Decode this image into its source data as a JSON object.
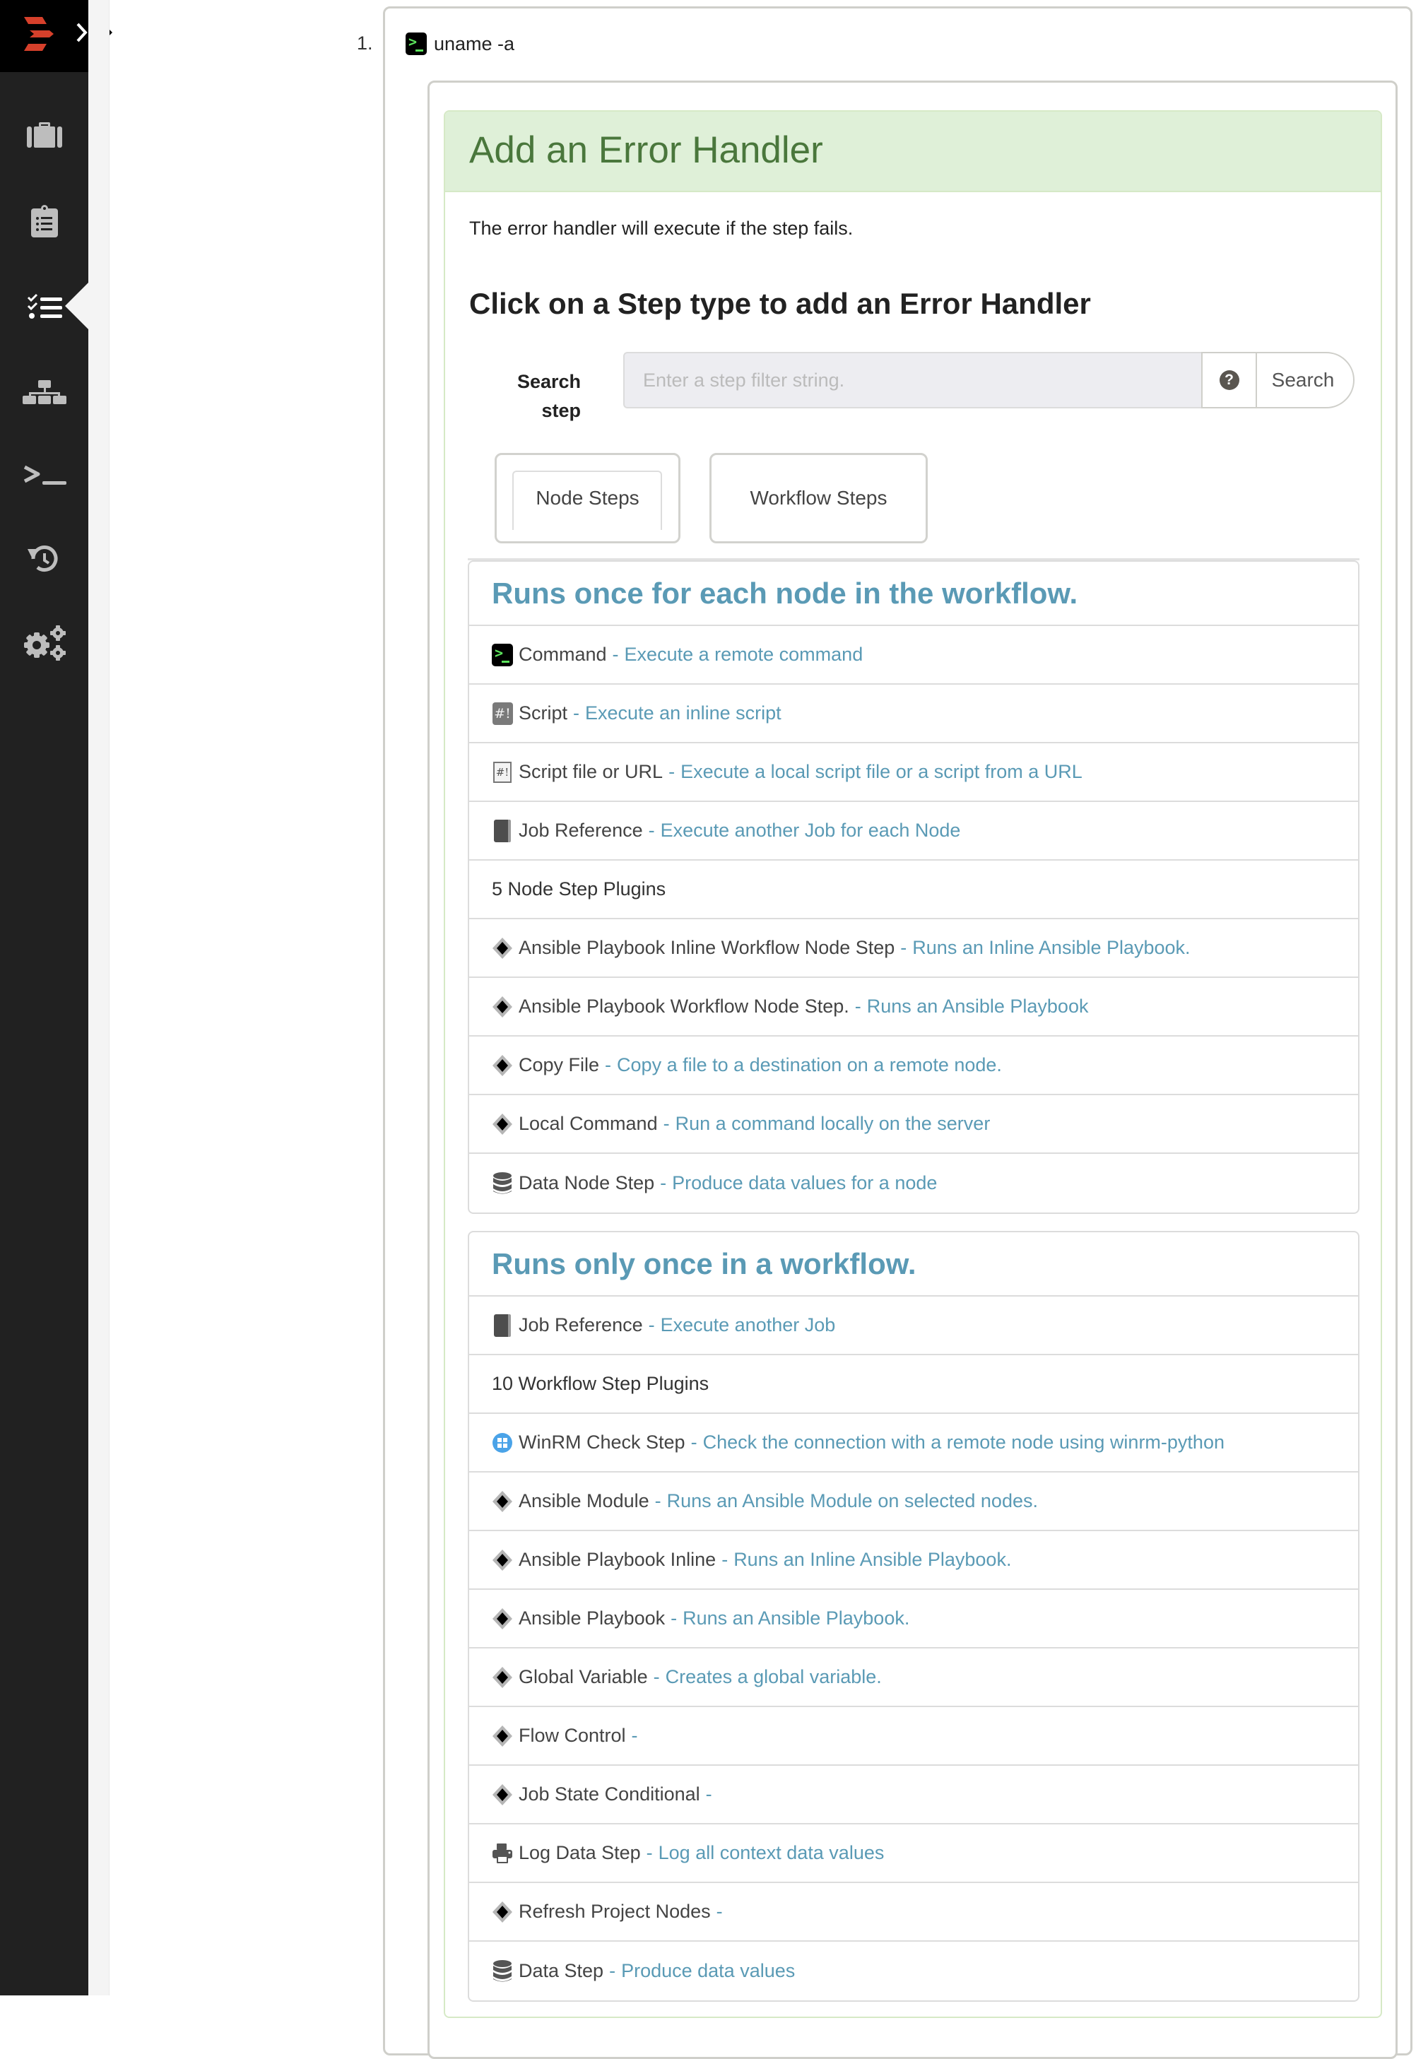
{
  "sidebar": {
    "logo": "rundeck-logo-icon",
    "expand_icon": "chevron-right-icon",
    "items": [
      {
        "name": "jobs",
        "icon": "briefcase-icon",
        "active": false
      },
      {
        "name": "activity",
        "icon": "clipboard-list-icon",
        "active": false
      },
      {
        "name": "workflow",
        "icon": "tasks-checklist-icon",
        "active": true
      },
      {
        "name": "nodes",
        "icon": "sitemap-icon",
        "active": false
      },
      {
        "name": "commands",
        "icon": "terminal-icon",
        "active": false
      },
      {
        "name": "history",
        "icon": "history-icon",
        "active": false
      },
      {
        "name": "settings",
        "icon": "gears-icon",
        "active": false
      }
    ]
  },
  "workflow_step": {
    "number": "1.",
    "icon": "terminal-icon",
    "title": "uname -a"
  },
  "error_handler": {
    "title": "Add an Error Handler",
    "description": "The error handler will execute if the step fails.",
    "heading": "Click on a Step type to add an Error Handler",
    "search": {
      "label": "Search step",
      "placeholder": "Enter a step filter string.",
      "value": "",
      "help_icon": "question-circle-icon",
      "button_label": "Search"
    },
    "tabs": [
      {
        "label": "Node Steps",
        "active": true
      },
      {
        "label": "Workflow Steps",
        "active": false
      }
    ],
    "node_steps": {
      "heading": "Runs once for each node in the workflow.",
      "rows": [
        {
          "icon": "terminal-icon",
          "name": "Command",
          "sep": "-",
          "desc": "Execute a remote command"
        },
        {
          "icon": "script-icon",
          "name": "Script",
          "sep": "-",
          "desc": "Execute an inline script"
        },
        {
          "icon": "script-file-icon",
          "name": "Script file or URL",
          "sep": "-",
          "desc": "Execute a local script file or a script from a URL"
        },
        {
          "icon": "book-icon",
          "name": "Job Reference",
          "sep": "-",
          "desc": "Execute another Job for each Node"
        },
        {
          "plain": true,
          "name": "5 Node Step Plugins"
        },
        {
          "icon": "plugin-diamond-icon",
          "name": "Ansible Playbook Inline Workflow Node Step",
          "sep": "-",
          "desc": "Runs an Inline Ansible Playbook."
        },
        {
          "icon": "plugin-diamond-icon",
          "name": "Ansible Playbook Workflow Node Step.",
          "sep": "-",
          "desc": "Runs an Ansible Playbook"
        },
        {
          "icon": "plugin-diamond-icon",
          "name": "Copy File",
          "sep": "-",
          "desc": "Copy a file to a destination on a remote node."
        },
        {
          "icon": "plugin-diamond-icon",
          "name": "Local Command",
          "sep": "-",
          "desc": "Run a command locally on the server"
        },
        {
          "icon": "database-icon",
          "name": "Data Node Step",
          "sep": "-",
          "desc": "Produce data values for a node"
        }
      ]
    },
    "workflow_steps": {
      "heading": "Runs only once in a workflow.",
      "rows": [
        {
          "icon": "book-icon",
          "name": "Job Reference",
          "sep": "-",
          "desc": "Execute another Job"
        },
        {
          "plain": true,
          "name": "10 Workflow Step Plugins"
        },
        {
          "icon": "windows-icon",
          "name": "WinRM Check Step",
          "sep": "-",
          "desc": "Check the connection with a remote node using winrm-python"
        },
        {
          "icon": "plugin-diamond-icon",
          "name": "Ansible Module",
          "sep": "-",
          "desc": "Runs an Ansible Module on selected nodes."
        },
        {
          "icon": "plugin-diamond-icon",
          "name": "Ansible Playbook Inline",
          "sep": "-",
          "desc": "Runs an Inline Ansible Playbook."
        },
        {
          "icon": "plugin-diamond-icon",
          "name": "Ansible Playbook",
          "sep": "-",
          "desc": "Runs an Ansible Playbook."
        },
        {
          "icon": "plugin-diamond-icon",
          "name": "Global Variable",
          "sep": "-",
          "desc": "Creates a global variable."
        },
        {
          "icon": "plugin-diamond-icon",
          "name": "Flow Control",
          "sep": "-",
          "desc": ""
        },
        {
          "icon": "plugin-diamond-icon",
          "name": "Job State Conditional",
          "sep": "-",
          "desc": ""
        },
        {
          "icon": "print-icon",
          "name": "Log Data Step",
          "sep": "-",
          "desc": "Log all context data values"
        },
        {
          "icon": "plugin-diamond-icon",
          "name": "Refresh Project Nodes",
          "sep": "-",
          "desc": ""
        },
        {
          "icon": "database-icon",
          "name": "Data Step",
          "sep": "-",
          "desc": "Produce data values"
        }
      ]
    }
  },
  "colors": {
    "sidebar_bg": "#212121",
    "logo_red": "#d6402b",
    "success_header_bg": "#dff0d8",
    "success_header_text": "#4a773c",
    "link_blue": "#5a9ab5",
    "terminal_green": "#5ce35c",
    "windows_blue": "#4aa3e8"
  }
}
